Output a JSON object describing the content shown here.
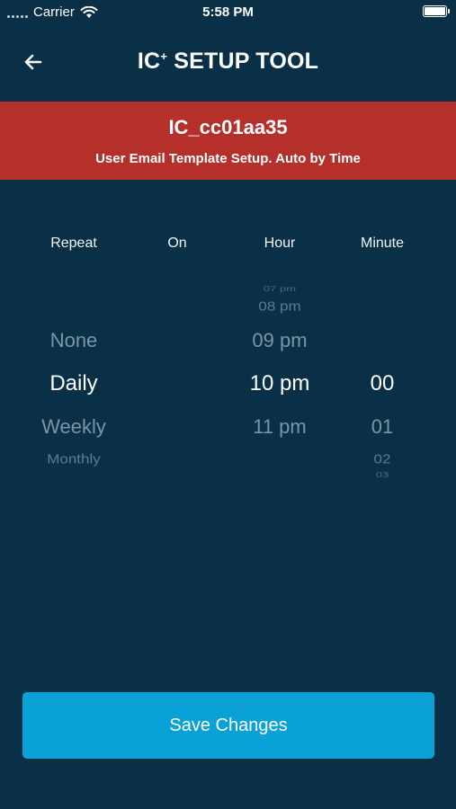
{
  "status_bar": {
    "carrier": "Carrier",
    "time": "5:58 PM"
  },
  "nav": {
    "title_main": "IC",
    "title_sup": "+",
    "title_rest": " SETUP TOOL"
  },
  "banner": {
    "device_id": "IC_cc01aa35",
    "subtitle": "User Email Template Setup. Auto by Time"
  },
  "picker": {
    "headers": {
      "repeat": "Repeat",
      "on": "On",
      "hour": "Hour",
      "minute": "Minute"
    },
    "repeat": {
      "above": "None",
      "selected": "Daily",
      "below1": "Weekly",
      "below2": "Monthly"
    },
    "hour": {
      "above3": "07 pm",
      "above2": "08 pm",
      "above1": "09 pm",
      "selected": "10 pm",
      "below1": "11 pm"
    },
    "minute": {
      "selected": "00",
      "below1": "01",
      "below2": "02",
      "below3": "03"
    }
  },
  "save_button": {
    "label": "Save Changes"
  },
  "colors": {
    "background": "#0a3047",
    "banner": "#b5302b",
    "button": "#0aa1d6"
  }
}
